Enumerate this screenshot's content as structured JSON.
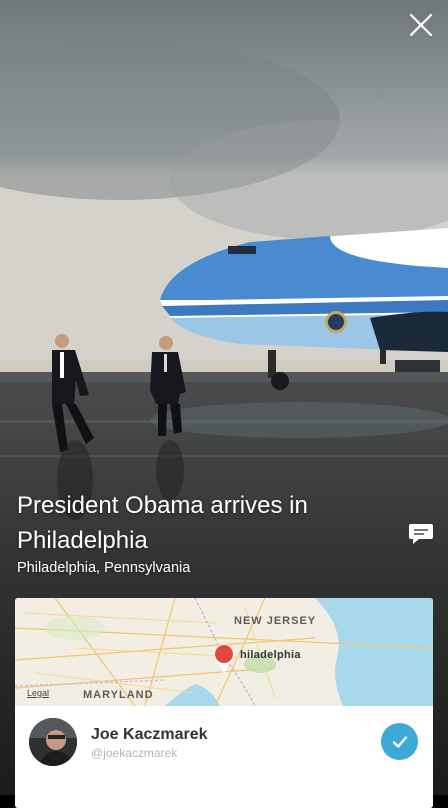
{
  "story": {
    "title": "President Obama arrives in Philadelphia",
    "location": "Philadelphia, Pennsylvania"
  },
  "map": {
    "labels": {
      "new_jersey": "NEW JERSEY",
      "philadelphia": "hiladelphia",
      "maryland": "MARYLAND",
      "legal": "Legal"
    },
    "pin_color": "#e0463d"
  },
  "user": {
    "name": "Joe Kaczmarek",
    "handle": "@joekaczmarek",
    "following": true
  },
  "icons": {
    "close": "close-icon",
    "comment": "comment-icon",
    "follow": "checkmark-icon",
    "map_pin": "map-pin-icon"
  },
  "colors": {
    "accent": "#3ea8d6",
    "pin": "#e0463d",
    "caption_text": "#ffffff"
  }
}
